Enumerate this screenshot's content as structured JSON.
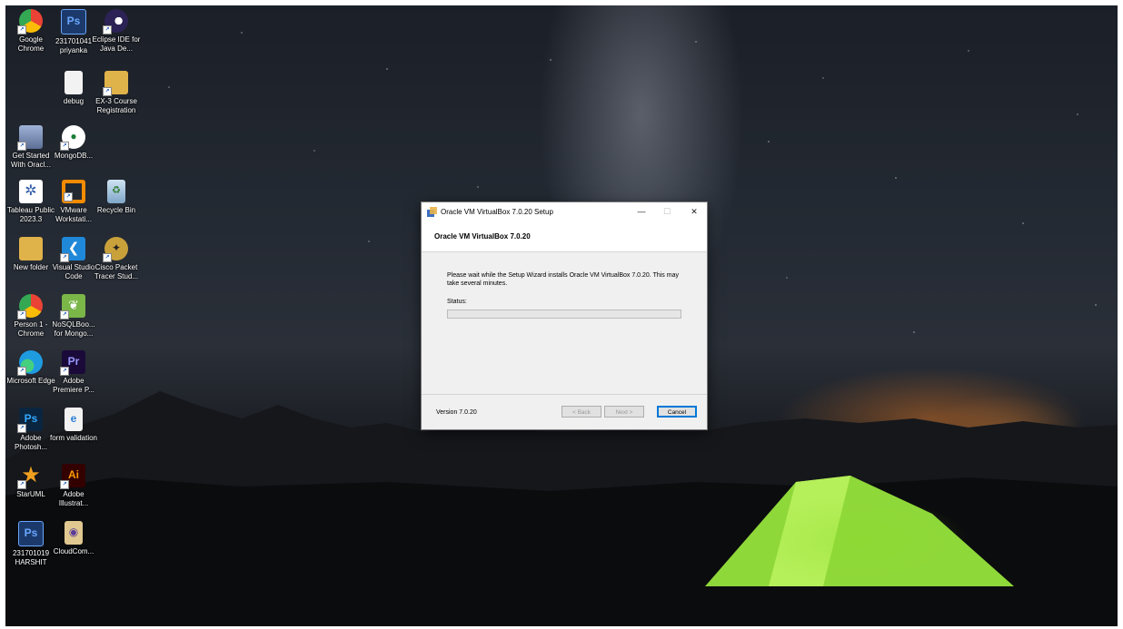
{
  "desktop": {
    "icons": [
      {
        "label": "Google Chrome",
        "glyph": "",
        "color": "#4285f4"
      },
      {
        "label": "231701041 priyanka",
        "glyph": "Ps",
        "color": "#1b3a6b"
      },
      {
        "label": "Eclipse IDE for Java De...",
        "glyph": "",
        "color": "#2c2255"
      },
      {
        "label": "debug",
        "glyph": "",
        "color": "#f2f2f2"
      },
      {
        "label": "EX-3 Course Registration",
        "glyph": "",
        "color": "#e0b24a"
      },
      {
        "label": "Get Started With Oracl...",
        "glyph": "",
        "color": "#6a7fa8"
      },
      {
        "label": "MongoDB...",
        "glyph": "",
        "color": "#ffffff"
      },
      {
        "label": "Tableau Public 2023.3",
        "glyph": "",
        "color": "#2e5aa8"
      },
      {
        "label": "VMware Workstati...",
        "glyph": "",
        "color": "#f38b00"
      },
      {
        "label": "Recycle Bin",
        "glyph": "",
        "color": "#8fb6d8"
      },
      {
        "label": "New folder",
        "glyph": "",
        "color": "#e0b24a"
      },
      {
        "label": "Visual Studio Code",
        "glyph": "",
        "color": "#1f88d8"
      },
      {
        "label": "Cisco Packet Tracer Stud...",
        "glyph": "",
        "color": "#c9a13b"
      },
      {
        "label": "Person 1 - Chrome",
        "glyph": "",
        "color": "#ea4335"
      },
      {
        "label": "NoSQLBoo... for Mongo...",
        "glyph": "",
        "color": "#7ab648"
      },
      {
        "label": "Microsoft Edge",
        "glyph": "",
        "color": "#1f9be0"
      },
      {
        "label": "Adobe Premiere P...",
        "glyph": "Pr",
        "color": "#1a0a3a"
      },
      {
        "label": "Adobe Photosh...",
        "glyph": "Ps",
        "color": "#0a2540"
      },
      {
        "label": "form validation",
        "glyph": "",
        "color": "#2f7fd6"
      },
      {
        "label": "StarUML",
        "glyph": "",
        "color": "#e8482c"
      },
      {
        "label": "Adobe Illustrat...",
        "glyph": "Ai",
        "color": "#330000"
      },
      {
        "label": "231701019 HARSHIT",
        "glyph": "Ps",
        "color": "#1b3a6b"
      },
      {
        "label": "CloudCom...",
        "glyph": "",
        "color": "#e0c890"
      }
    ]
  },
  "dialog": {
    "title": "Oracle VM VirtualBox 7.0.20 Setup",
    "minimize": "—",
    "maximize": "☐",
    "close": "✕",
    "header": "Oracle VM VirtualBox 7.0.20",
    "message": "Please wait while the Setup Wizard installs Oracle VM VirtualBox 7.0.20. This may take several minutes.",
    "status_label": "Status:",
    "progress": 0,
    "version": "Version 7.0.20",
    "back_label": "< Back",
    "next_label": "Next >",
    "cancel_label": "Cancel"
  }
}
